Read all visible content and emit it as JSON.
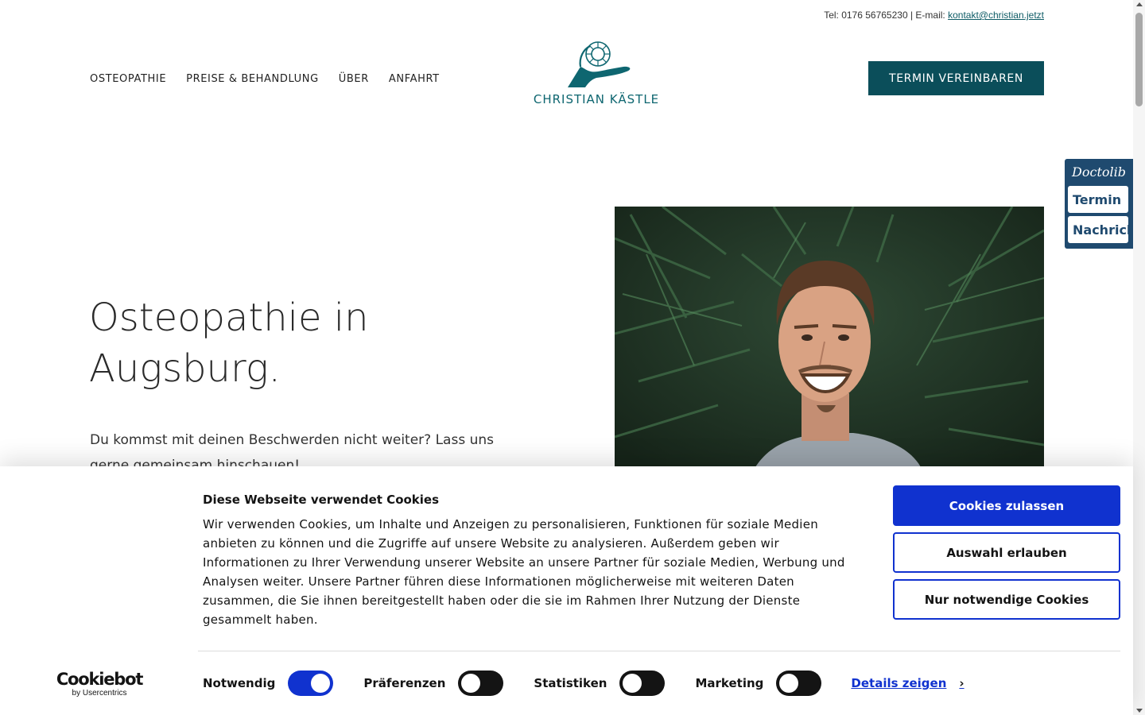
{
  "header": {
    "contact_prefix": "Tel: 0176 56765230 | E-mail: ",
    "email": "kontakt@christian.jetzt",
    "nav": [
      {
        "label": "OSTEOPATHIE"
      },
      {
        "label": "PREISE & BEHANDLUNG"
      },
      {
        "label": "ÜBER"
      },
      {
        "label": "ANFAHRT"
      }
    ],
    "logo_text": "CHRISTIAN KÄSTLE",
    "cta_label": "TERMIN VEREINBAREN"
  },
  "doctolib": {
    "brand": "Doctolib",
    "buttons": [
      "Termin",
      "Nachricht"
    ]
  },
  "hero": {
    "title_line1": "Osteopathie in",
    "title_line2": "Augsburg.",
    "subtitle": "Du kommst mit deinen Beschwerden nicht weiter? Lass uns gerne gemeinsam hinschauen!"
  },
  "cookie_banner": {
    "title": "Diese Webseite verwendet Cookies",
    "text": "Wir verwenden Cookies, um Inhalte und Anzeigen zu personalisieren, Funktionen für soziale Medien anbieten zu können und die Zugriffe auf unsere Website zu analysieren. Außerdem geben wir Informationen zu Ihrer Verwendung unserer Website an unsere Partner für soziale Medien, Werbung und Analysen weiter. Unsere Partner führen diese Informationen möglicherweise mit weiteren Daten zusammen, die Sie ihnen bereitgestellt haben oder die sie im Rahmen Ihrer Nutzung der Dienste gesammelt haben.",
    "buttons": {
      "allow_all": "Cookies zulassen",
      "allow_selection": "Auswahl erlauben",
      "necessary_only": "Nur notwendige Cookies"
    },
    "brand": {
      "name": "Cookiebot",
      "by": "by Usercentrics"
    },
    "toggles": [
      {
        "label": "Notwendig",
        "on": true
      },
      {
        "label": "Präferenzen",
        "on": false
      },
      {
        "label": "Statistiken",
        "on": false
      },
      {
        "label": "Marketing",
        "on": false
      }
    ],
    "details_label": "Details zeigen"
  },
  "colors": {
    "brand_teal": "#0b4e5a",
    "logo_teal": "#0e6670",
    "cookie_blue": "#1032cf",
    "doctolib_blue": "#1f4a6f"
  }
}
